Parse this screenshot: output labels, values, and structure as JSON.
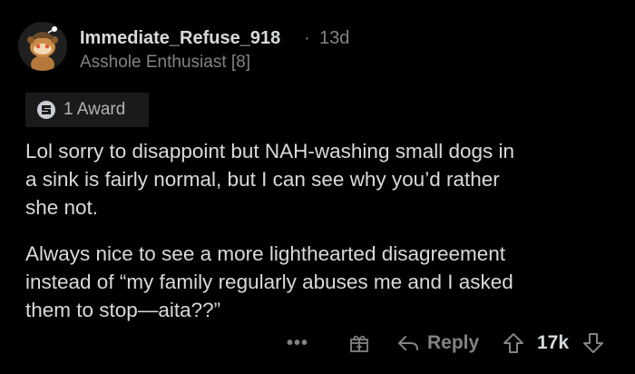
{
  "comment": {
    "author": "Immediate_Refuse_918",
    "separator": "·",
    "age": "13d",
    "flair": "Asshole Enthusiast [8]",
    "award": {
      "icon": "silver-award-icon",
      "label": "1 Award"
    },
    "paragraphs": [
      "Lol sorry to disappoint but NAH-washing small dogs in\na sink is fairly normal, but I can see why you’d rather\nshe not.",
      "Always nice to see a more lighthearted disagreement\ninstead of “my family regularly abuses me and I asked\nthem to stop—aita??”"
    ],
    "actions": {
      "more_label": "•••",
      "gift_icon": "gift-icon",
      "reply_label": "Reply",
      "score": "17k"
    }
  },
  "colors": {
    "background": "#000000",
    "text": "#d7dadc",
    "muted": "#818384",
    "award_bg": "#1a1a1b"
  }
}
